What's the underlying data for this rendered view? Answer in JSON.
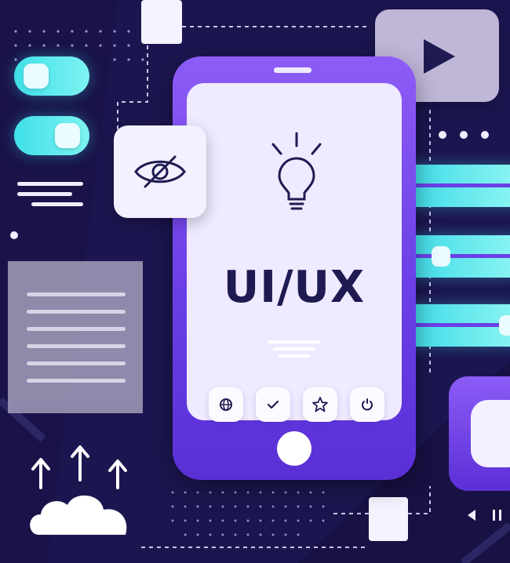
{
  "screen": {
    "title": "UI/UX"
  },
  "icons": {
    "eye": "eye-slash-icon",
    "lightbulb": "lightbulb-icon",
    "play": "play-icon",
    "cloud": "cloud-upload-icon",
    "buttons": [
      "globe-icon",
      "check-icon",
      "star-icon",
      "power-icon"
    ]
  },
  "colors": {
    "background": "#1c1650",
    "phone": "#6b3fe6",
    "screen": "#efeaff",
    "accent_cyan": "#3fe0e8",
    "text_dark": "#1f1b52"
  }
}
